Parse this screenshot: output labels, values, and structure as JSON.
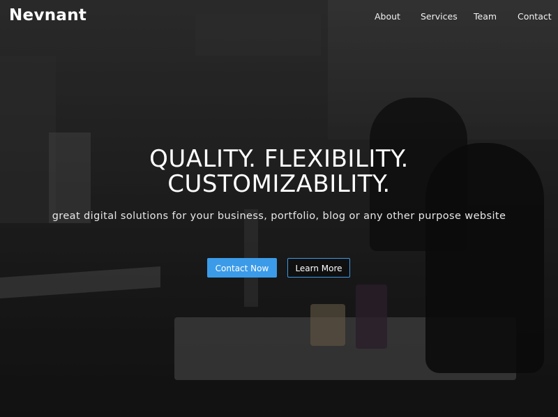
{
  "brand": {
    "name": "Nevnant"
  },
  "nav": {
    "items": [
      {
        "label": "About"
      },
      {
        "label": "Services"
      },
      {
        "label": "Team"
      },
      {
        "label": "Contact"
      }
    ]
  },
  "hero": {
    "headline_line1": "QUALITY. FLEXIBILITY.",
    "headline_line2": "CUSTOMIZABILITY.",
    "subtitle": "great digital solutions for your business, portfolio, blog or any other purpose website",
    "primary_button": "Contact Now",
    "secondary_button": "Learn More"
  },
  "colors": {
    "accent": "#3b9be8",
    "text": "#ffffff",
    "overlay": "#000000"
  }
}
